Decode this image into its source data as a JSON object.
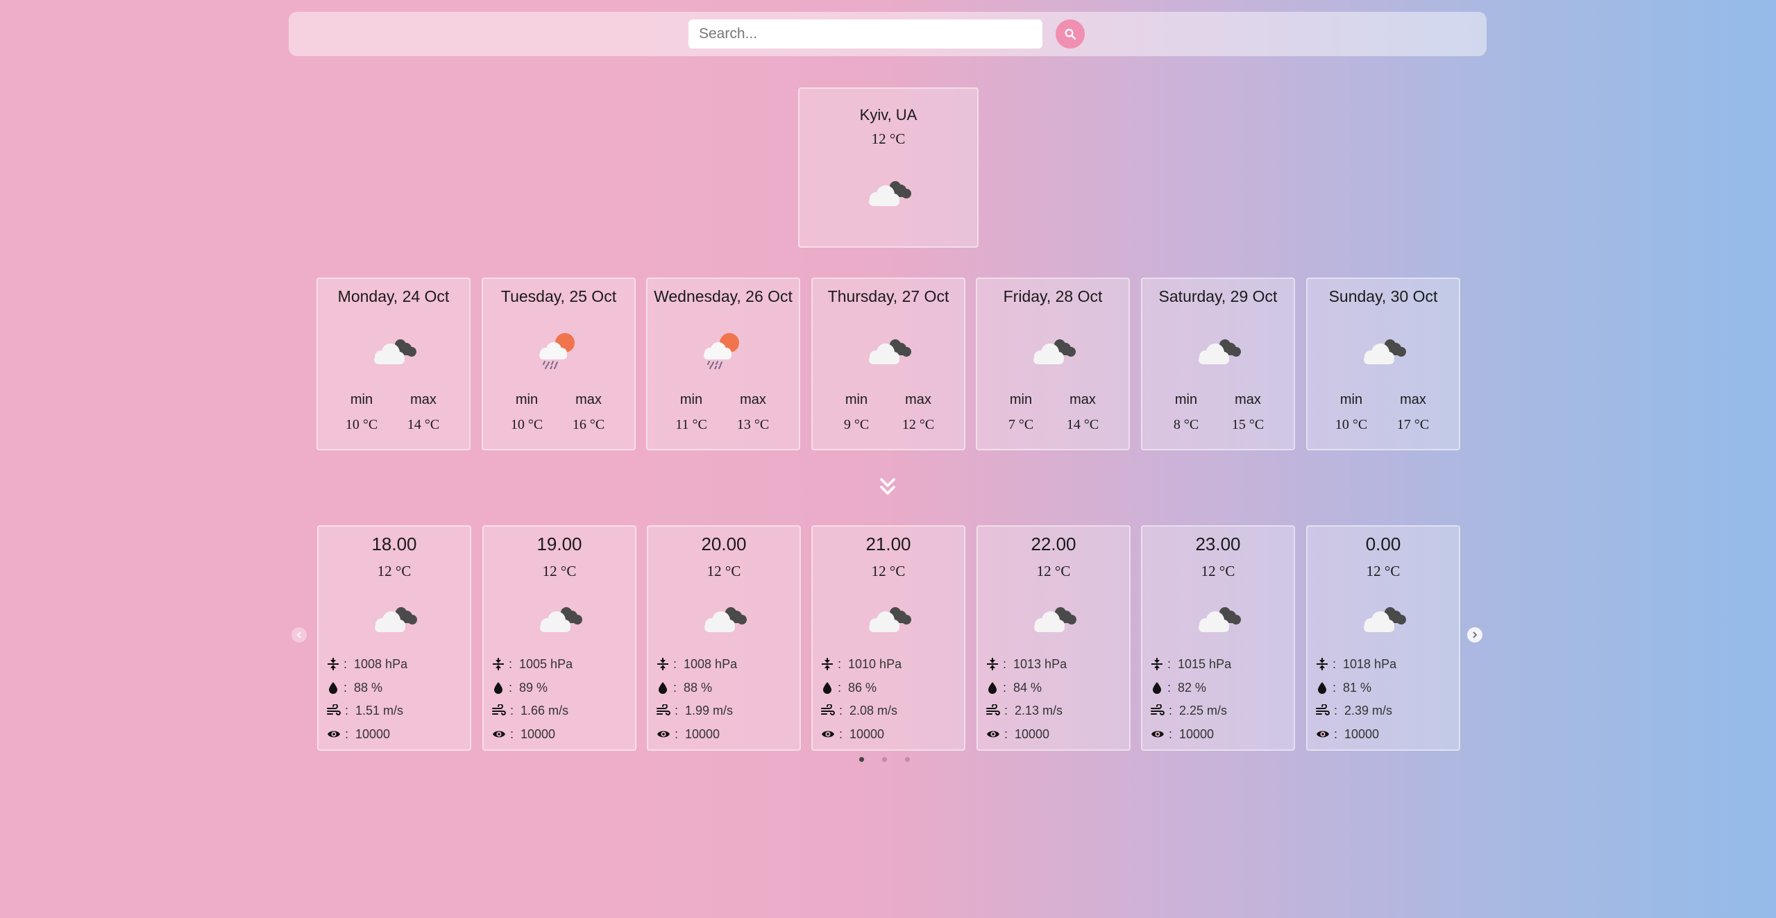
{
  "search": {
    "placeholder": "Search...",
    "value": ""
  },
  "current": {
    "city": "Kyiv, UA",
    "temp": "12 °C",
    "icon": "cloudy-icon"
  },
  "days": [
    {
      "title": "Monday, 24 Oct",
      "icon": "cloudy-icon",
      "min_label": "min",
      "max_label": "max",
      "min": "10 °C",
      "max": "14 °C"
    },
    {
      "title": "Tuesday, 25 Oct",
      "icon": "rain-sun-icon",
      "min_label": "min",
      "max_label": "max",
      "min": "10 °C",
      "max": "16 °C"
    },
    {
      "title": "Wednesday, 26 Oct",
      "icon": "rain-sun-icon",
      "min_label": "min",
      "max_label": "max",
      "min": "11 °C",
      "max": "13 °C"
    },
    {
      "title": "Thursday, 27 Oct",
      "icon": "cloudy-icon",
      "min_label": "min",
      "max_label": "max",
      "min": "9 °C",
      "max": "12 °C"
    },
    {
      "title": "Friday, 28 Oct",
      "icon": "cloudy-icon",
      "min_label": "min",
      "max_label": "max",
      "min": "7 °C",
      "max": "14 °C"
    },
    {
      "title": "Saturday, 29 Oct",
      "icon": "cloudy-icon",
      "min_label": "min",
      "max_label": "max",
      "min": "8 °C",
      "max": "15 °C"
    },
    {
      "title": "Sunday, 30 Oct",
      "icon": "cloudy-icon",
      "min_label": "min",
      "max_label": "max",
      "min": "10 °C",
      "max": "17 °C"
    }
  ],
  "hours": [
    {
      "time": "18.00",
      "temp": "12 °C",
      "icon": "cloudy-icon",
      "pressure": "1008 hPa",
      "humidity": "88 %",
      "wind": "1.51 m/s",
      "visibility": "10000"
    },
    {
      "time": "19.00",
      "temp": "12 °C",
      "icon": "cloudy-icon",
      "pressure": "1005 hPa",
      "humidity": "89 %",
      "wind": "1.66 m/s",
      "visibility": "10000"
    },
    {
      "time": "20.00",
      "temp": "12 °C",
      "icon": "cloudy-icon",
      "pressure": "1008 hPa",
      "humidity": "88 %",
      "wind": "1.99 m/s",
      "visibility": "10000"
    },
    {
      "time": "21.00",
      "temp": "12 °C",
      "icon": "cloudy-icon",
      "pressure": "1010 hPa",
      "humidity": "86 %",
      "wind": "2.08 m/s",
      "visibility": "10000"
    },
    {
      "time": "22.00",
      "temp": "12 °C",
      "icon": "cloudy-icon",
      "pressure": "1013 hPa",
      "humidity": "84 %",
      "wind": "2.13 m/s",
      "visibility": "10000"
    },
    {
      "time": "23.00",
      "temp": "12 °C",
      "icon": "cloudy-icon",
      "pressure": "1015 hPa",
      "humidity": "82 %",
      "wind": "2.25 m/s",
      "visibility": "10000"
    },
    {
      "time": "0.00",
      "temp": "12 °C",
      "icon": "cloudy-icon",
      "pressure": "1018 hPa",
      "humidity": "81 %",
      "wind": "2.39 m/s",
      "visibility": "10000"
    }
  ],
  "stat_separator": ":",
  "pagination": {
    "pages": 3,
    "active": 1
  },
  "colors": {
    "accent": "#f08fb1",
    "gradient_start": "#eeaec9",
    "gradient_end": "#94bbe9"
  }
}
